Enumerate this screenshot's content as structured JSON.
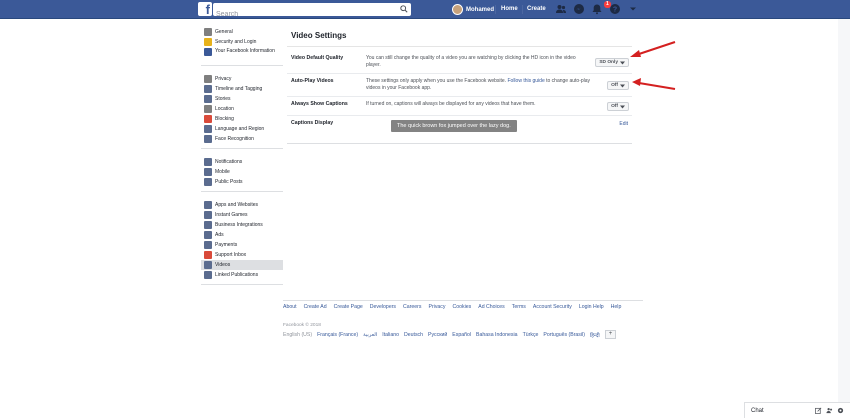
{
  "topbar": {
    "search_placeholder": "Search",
    "user_name": "Mohamed",
    "home_label": "Home",
    "create_label": "Create",
    "notifications_count": "1"
  },
  "sidebar": {
    "groups": [
      [
        {
          "label": "General",
          "icon": "gear-icon",
          "color": "#7f7f7f"
        },
        {
          "label": "Security and Login",
          "icon": "shield-icon",
          "color": "#e7b21c"
        },
        {
          "label": "Your Facebook Information",
          "icon": "facebook-icon",
          "color": "#3b5998"
        }
      ],
      [
        {
          "label": "Privacy",
          "icon": "lock-icon",
          "color": "#7f7f7f"
        },
        {
          "label": "Timeline and Tagging",
          "icon": "timeline-icon",
          "color": "#5b6c8f"
        },
        {
          "label": "Stories",
          "icon": "stories-icon",
          "color": "#5b6c8f"
        },
        {
          "label": "Location",
          "icon": "location-icon",
          "color": "#7f7f7f"
        },
        {
          "label": "Blocking",
          "icon": "blocking-icon",
          "color": "#d94a3a"
        },
        {
          "label": "Language and Region",
          "icon": "language-icon",
          "color": "#5b6c8f"
        },
        {
          "label": "Face Recognition",
          "icon": "face-icon",
          "color": "#5b6c8f"
        }
      ],
      [
        {
          "label": "Notifications",
          "icon": "globe-icon",
          "color": "#5b6c8f"
        },
        {
          "label": "Mobile",
          "icon": "mobile-icon",
          "color": "#5b6c8f"
        },
        {
          "label": "Public Posts",
          "icon": "rss-icon",
          "color": "#5b6c8f"
        }
      ],
      [
        {
          "label": "Apps and Websites",
          "icon": "apps-icon",
          "color": "#5b6c8f"
        },
        {
          "label": "Instant Games",
          "icon": "games-icon",
          "color": "#5b6c8f"
        },
        {
          "label": "Business Integrations",
          "icon": "business-icon",
          "color": "#5b6c8f"
        },
        {
          "label": "Ads",
          "icon": "ads-icon",
          "color": "#5b6c8f"
        },
        {
          "label": "Payments",
          "icon": "card-icon",
          "color": "#5b6c8f"
        },
        {
          "label": "Support Inbox",
          "icon": "support-icon",
          "color": "#d94a3a"
        },
        {
          "label": "Videos",
          "icon": "video-icon",
          "color": "#5b6c8f",
          "active": true
        },
        {
          "label": "Linked Publications",
          "icon": "publications-icon",
          "color": "#5b6c8f"
        }
      ]
    ]
  },
  "main": {
    "title": "Video Settings",
    "rows": [
      {
        "label": "Video Default Quality",
        "desc": "You can still change the quality of a video you are watching by clicking the HD icon in the video player.",
        "value": "SD Only"
      },
      {
        "label": "Auto-Play Videos",
        "desc_pre": "These settings only apply when you use the Facebook website. ",
        "desc_link": "Follow this guide",
        "desc_post": " to change auto-play videos in your Facebook app.",
        "value": "Off"
      },
      {
        "label": "Always Show Captions",
        "desc": "If turned on, captions will always be displayed for any videos that have them.",
        "value": "Off"
      },
      {
        "label": "Captions Display",
        "sample": "The quick brown fox jumped over the lazy dog.",
        "edit": "Edit"
      }
    ]
  },
  "footer": {
    "links": [
      "About",
      "Create Ad",
      "Create Page",
      "Developers",
      "Careers",
      "Privacy",
      "Cookies",
      "Ad Choices",
      "Terms",
      "Account Security",
      "Login Help",
      "Help"
    ],
    "copyright": "Facebook © 2018",
    "languages": [
      "English (US)",
      "Français (France)",
      "العربية",
      "Italiano",
      "Deutsch",
      "Русский",
      "Español",
      "Bahasa Indonesia",
      "Türkçe",
      "Português (Brasil)",
      "हिन्दी"
    ],
    "add_language": "+"
  },
  "chat": {
    "label": "Chat"
  }
}
